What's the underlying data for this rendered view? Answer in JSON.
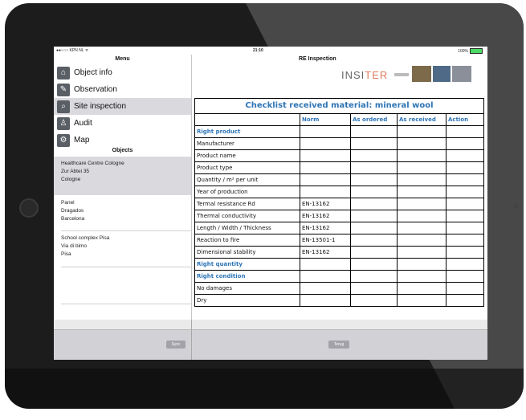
{
  "status_bar": {
    "carrier": "●●○○○ KPN NL ᯤ",
    "time": "21:10",
    "battery": "100%"
  },
  "sidebar": {
    "menu_title": "Menu",
    "items": [
      {
        "label": "Object info",
        "icon": "object-info-icon",
        "glyph": "⌂"
      },
      {
        "label": "Observation",
        "icon": "pencil-icon",
        "glyph": "✎"
      },
      {
        "label": "Site inspection",
        "icon": "magnifier-icon",
        "glyph": "⌕"
      },
      {
        "label": "Audit",
        "icon": "audit-icon",
        "glyph": "♙"
      },
      {
        "label": "Map",
        "icon": "map-icon",
        "glyph": "⚙"
      }
    ],
    "objects_title": "Objects",
    "objects": [
      {
        "name": "Healthcare Centre Cologne",
        "street": "Zur Abtei 35",
        "city": "Cologne"
      },
      {
        "name": "Panel",
        "street": "Dragados",
        "city": "Barcelona"
      },
      {
        "name": "School complex Pisa",
        "street": "Via di bimo",
        "city": "Pisa"
      }
    ]
  },
  "main": {
    "header_title": "RE Inspection",
    "logo": {
      "text_a": "INSI",
      "text_b": "TER"
    },
    "checklist": {
      "title": "Checklist received material: mineral wool",
      "columns": [
        "",
        "Norm",
        "As ordered",
        "As received",
        "Action"
      ],
      "rows": [
        {
          "label": "Right product",
          "norm": "",
          "section": true
        },
        {
          "label": "Manufacturer",
          "norm": ""
        },
        {
          "label": "Product name",
          "norm": ""
        },
        {
          "label": "Product type",
          "norm": ""
        },
        {
          "label": "Quantity / m² per unit",
          "norm": ""
        },
        {
          "label": "Year of production",
          "norm": ""
        },
        {
          "label": "Termal resistance Rd",
          "norm": "EN-13162"
        },
        {
          "label": "Thermal conductivity",
          "norm": "EN-13162"
        },
        {
          "label": "Length / Width / Thickness",
          "norm": "EN-13162"
        },
        {
          "label": "Reaction to fire",
          "norm": "EN-13501-1"
        },
        {
          "label": "Dimensional stability",
          "norm": "EN-13162"
        },
        {
          "label": "Right quantity",
          "norm": "",
          "section": true
        },
        {
          "label": "Right condition",
          "norm": "",
          "section": true
        },
        {
          "label": "No damages",
          "norm": ""
        },
        {
          "label": "Dry",
          "norm": ""
        }
      ]
    }
  },
  "toolbar": {
    "sync_label": "Sync",
    "back_label": "Terug"
  }
}
